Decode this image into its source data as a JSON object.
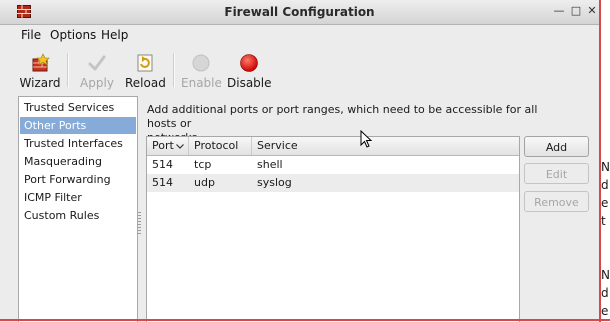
{
  "window": {
    "title": "Firewall Configuration"
  },
  "menu": [
    "File",
    "Options",
    "Help"
  ],
  "toolbar": {
    "wizard": "Wizard",
    "apply": "Apply",
    "reload": "Reload",
    "enable": "Enable",
    "disable": "Disable"
  },
  "sidebar": {
    "items": [
      {
        "label": "Trusted Services"
      },
      {
        "label": "Other Ports",
        "selected": true
      },
      {
        "label": "Trusted Interfaces"
      },
      {
        "label": "Masquerading"
      },
      {
        "label": "Port Forwarding"
      },
      {
        "label": "ICMP Filter"
      },
      {
        "label": "Custom Rules"
      }
    ]
  },
  "main": {
    "description_line1": "Add additional ports or port ranges, which need to be accessible for all hosts or",
    "description_line2": "networks.",
    "table": {
      "columns": [
        "Port",
        "Protocol",
        "Service"
      ],
      "rows": [
        {
          "port": "514",
          "protocol": "tcp",
          "service": "shell"
        },
        {
          "port": "514",
          "protocol": "udp",
          "service": "syslog"
        }
      ]
    },
    "buttons": {
      "add": "Add",
      "edit": "Edit",
      "remove": "Remove"
    }
  },
  "background_text": [
    "N",
    "d",
    "e",
    "t",
    "N",
    "d",
    "e"
  ],
  "colors": {
    "selection": "#86abd9",
    "disable_icon": "#d40000",
    "accent_border": "#d44a4a"
  },
  "icons": [
    "firewall-app-icon",
    "minimize-icon",
    "maximize-icon",
    "close-icon",
    "wizard-icon",
    "apply-check-icon",
    "reload-icon",
    "enable-circle-icon",
    "disable-circle-icon",
    "sort-down-icon",
    "mouse-cursor-icon"
  ]
}
